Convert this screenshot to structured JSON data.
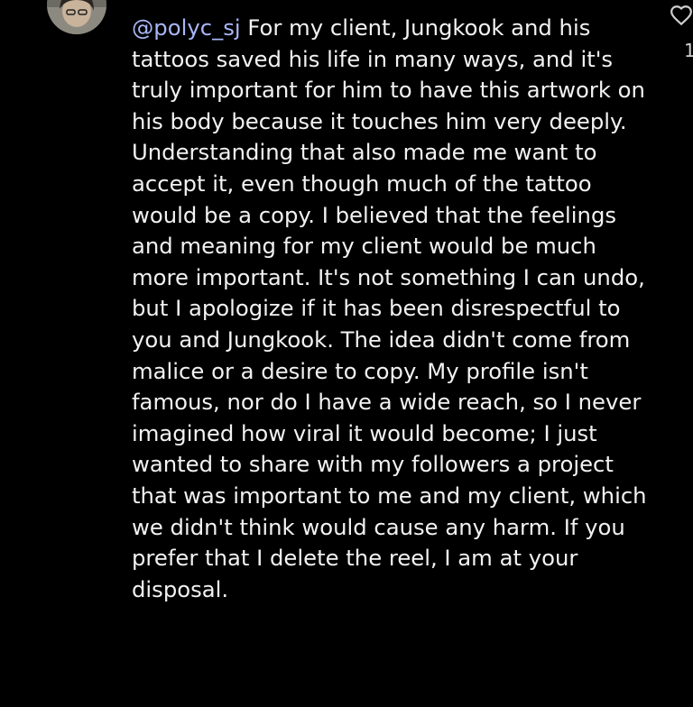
{
  "comment": {
    "username": "@polyc_sj",
    "text": "For my client, Jungkook and his tattoos saved his life in many ways, and it's truly important for him to have this artwork on his body because it touches him very deeply. Understanding that also made me want to accept it, even though much of the tattoo would be a copy. I believed that the feelings and meaning for my client would be much more important. It's not something I can undo, but I apologize if it has been disrespectful to you and Jungkook. The idea didn't come from malice or a desire to copy. My profile isn't famous, nor do I have a wide reach, so I never imagined how viral it would become; I just wanted to share with my followers a project that was important to me and my client, which we didn't think would cause any harm. If you prefer that I delete the reel, I am at your disposal."
  },
  "like": {
    "icon": "heart-outline-icon",
    "count": "1"
  },
  "colors": {
    "background": "#000000",
    "text": "#f2f2f2",
    "mention": "#a9b7f7"
  }
}
